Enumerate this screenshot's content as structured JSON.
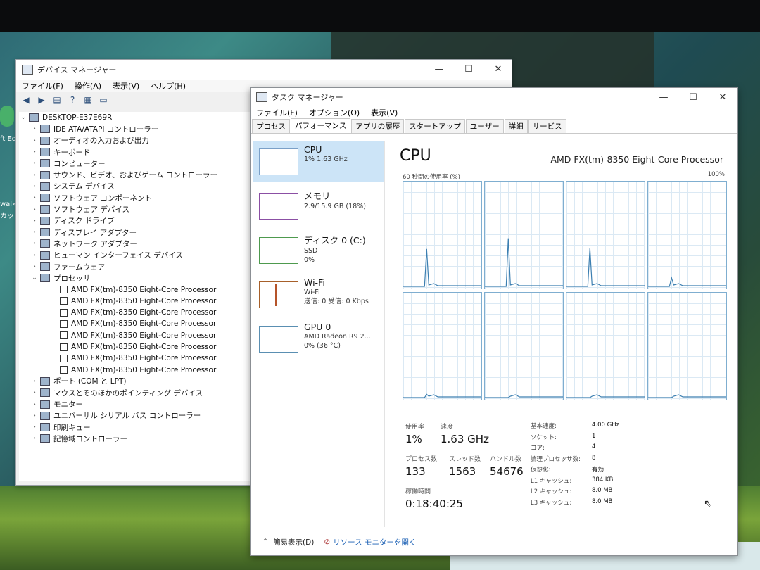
{
  "desktop": {
    "left_labels": [
      "ft Ed",
      "walk",
      "カット"
    ]
  },
  "device_manager": {
    "title": "デバイス マネージャー",
    "menu": [
      "ファイル(F)",
      "操作(A)",
      "表示(V)",
      "ヘルプ(H)"
    ],
    "root": "DESKTOP-E37E69R",
    "categories": [
      "IDE ATA/ATAPI コントローラー",
      "オーディオの入力および出力",
      "キーボード",
      "コンピューター",
      "サウンド、ビデオ、およびゲーム コントローラー",
      "システム デバイス",
      "ソフトウェア コンポーネント",
      "ソフトウェア デバイス",
      "ディスク ドライブ",
      "ディスプレイ アダプター",
      "ネットワーク アダプター",
      "ヒューマン インターフェイス デバイス",
      "ファームウェア",
      "プロセッサ"
    ],
    "processors": [
      "AMD FX(tm)-8350 Eight-Core Processor",
      "AMD FX(tm)-8350 Eight-Core Processor",
      "AMD FX(tm)-8350 Eight-Core Processor",
      "AMD FX(tm)-8350 Eight-Core Processor",
      "AMD FX(tm)-8350 Eight-Core Processor",
      "AMD FX(tm)-8350 Eight-Core Processor",
      "AMD FX(tm)-8350 Eight-Core Processor",
      "AMD FX(tm)-8350 Eight-Core Processor"
    ],
    "categories_after": [
      "ポート (COM と LPT)",
      "マウスとそのほかのポインティング デバイス",
      "モニター",
      "ユニバーサル シリアル バス コントローラー",
      "印刷キュー",
      "記憶域コントローラー"
    ]
  },
  "task_manager": {
    "title": "タスク マネージャー",
    "menu": [
      "ファイル(F)",
      "オプション(O)",
      "表示(V)"
    ],
    "tabs": [
      "プロセス",
      "パフォーマンス",
      "アプリの履歴",
      "スタートアップ",
      "ユーザー",
      "詳細",
      "サービス"
    ],
    "active_tab": "パフォーマンス",
    "sidebar": [
      {
        "name": "CPU",
        "l1": "1%  1.63 GHz",
        "l2": ""
      },
      {
        "name": "メモリ",
        "l1": "2.9/15.9 GB (18%)",
        "l2": ""
      },
      {
        "name": "ディスク 0 (C:)",
        "l1": "SSD",
        "l2": "0%"
      },
      {
        "name": "Wi-Fi",
        "l1": "Wi-Fi",
        "l2": "送信: 0 受信: 0 Kbps"
      },
      {
        "name": "GPU 0",
        "l1": "AMD Radeon R9 2...",
        "l2": "0%  (36 °C)"
      }
    ],
    "cpu": {
      "title": "CPU",
      "model": "AMD FX(tm)-8350 Eight-Core Processor",
      "graph_label": "60 秒間の使用率 (%)",
      "graph_max": "100%",
      "core_spikes": [
        0.35,
        0.45,
        0.36,
        0.08,
        0.03,
        0.0,
        0.0,
        0.0
      ]
    },
    "stats": {
      "usage_label": "使用率",
      "usage": "1%",
      "speed_label": "速度",
      "speed": "1.63 GHz",
      "processes_label": "プロセス数",
      "processes": "133",
      "threads_label": "スレッド数",
      "threads": "1563",
      "handles_label": "ハンドル数",
      "handles": "54676",
      "uptime_label": "稼働時間",
      "uptime": "0:18:40:25"
    },
    "right_stats": [
      {
        "k": "基本速度:",
        "v": "4.00 GHz"
      },
      {
        "k": "ソケット:",
        "v": "1"
      },
      {
        "k": "コア:",
        "v": "4"
      },
      {
        "k": "論理プロセッサ数:",
        "v": "8"
      },
      {
        "k": "仮想化:",
        "v": "有効"
      },
      {
        "k": "L1 キャッシュ:",
        "v": "384 KB"
      },
      {
        "k": "L2 キャッシュ:",
        "v": "8.0 MB"
      },
      {
        "k": "L3 キャッシュ:",
        "v": "8.0 MB"
      }
    ],
    "footer": {
      "summary": "簡易表示(D)",
      "resource_monitor": "リソース モニターを開く"
    }
  }
}
